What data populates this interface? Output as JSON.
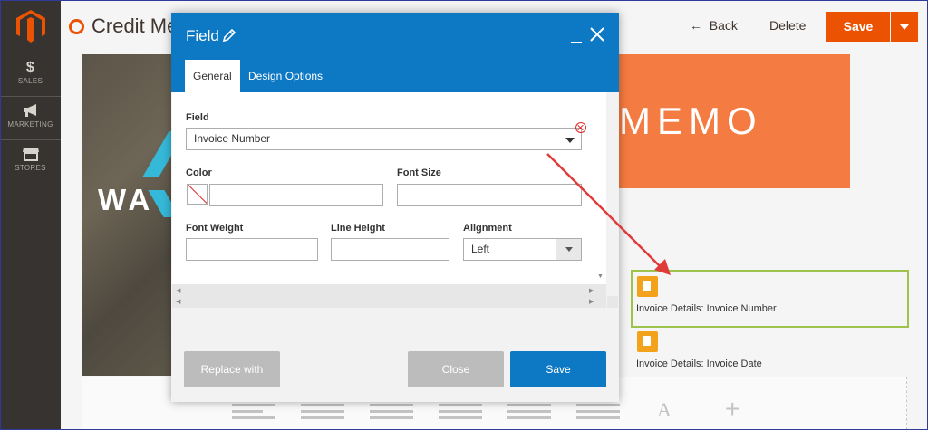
{
  "sidebar": {
    "items": [
      {
        "label": "SALES",
        "icon": "dollar-icon"
      },
      {
        "label": "MARKETING",
        "icon": "megaphone-icon"
      },
      {
        "label": "STORES",
        "icon": "store-icon"
      }
    ]
  },
  "header": {
    "title": "Credit Memo",
    "back_label": "Back",
    "delete_label": "Delete",
    "save_label": "Save"
  },
  "canvas": {
    "photo_text": "WA",
    "banner_text": "MEMO",
    "elements": [
      {
        "label": "Invoice Details: Invoice Number"
      },
      {
        "label": "Invoice Details: Invoice Date"
      }
    ],
    "toolbar_text_tool": "A",
    "toolbar_add_tool": "+"
  },
  "modal": {
    "title": "Field",
    "tabs": [
      {
        "label": "General",
        "active": true
      },
      {
        "label": "Design Options",
        "active": false
      }
    ],
    "field": {
      "label": "Field",
      "value": "Invoice Number"
    },
    "color": {
      "label": "Color",
      "value": ""
    },
    "font_size": {
      "label": "Font Size",
      "value": ""
    },
    "font_weight": {
      "label": "Font Weight",
      "value": ""
    },
    "line_height": {
      "label": "Line Height",
      "value": ""
    },
    "alignment": {
      "label": "Alignment",
      "value": "Left"
    },
    "buttons": {
      "replace": "Replace with",
      "close": "Close",
      "save": "Save"
    }
  },
  "colors": {
    "brand_orange": "#eb5202",
    "modal_blue": "#0d78c3",
    "sidebar_dark": "#373330",
    "selection_green": "#9dc34d",
    "annotation_red": "#e03b3b"
  }
}
